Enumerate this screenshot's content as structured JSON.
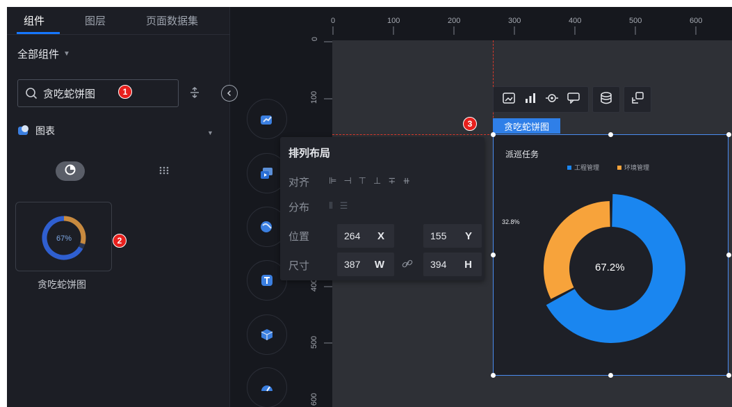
{
  "tabs": [
    {
      "label": "组件",
      "active": true
    },
    {
      "label": "图层",
      "active": false
    },
    {
      "label": "页面数据集",
      "active": false
    }
  ],
  "component_filter": {
    "label": "全部组件"
  },
  "search": {
    "value": "贪吃蛇饼图",
    "badge": "1"
  },
  "category": {
    "label": "图表"
  },
  "component_card": {
    "percent": "67%",
    "label": "贪吃蛇饼图",
    "badge": "2"
  },
  "ruler": {
    "top_ticks": [
      "0",
      "100",
      "200",
      "300",
      "400",
      "500",
      "600"
    ],
    "left_ticks": [
      "0",
      "100",
      "400",
      "500",
      "600"
    ]
  },
  "layout_panel": {
    "title": "排列布局",
    "align_label": "对齐",
    "distribute_label": "分布",
    "position_label": "位置",
    "size_label": "尺寸",
    "x_value": "264",
    "x_unit": "X",
    "y_value": "155",
    "y_unit": "Y",
    "w_value": "387",
    "w_unit": "W",
    "h_value": "394",
    "h_unit": "H"
  },
  "widget": {
    "tag": "贪吃蛇饼图",
    "badge": "3",
    "title": "派巡任务",
    "legend": [
      {
        "label": "工程管理",
        "color": "#1a86f0"
      },
      {
        "label": "环境管理",
        "color": "#f7a33b"
      }
    ],
    "side_percent": "32.8%",
    "center_percent": "67.2%"
  },
  "chart_data": {
    "type": "pie",
    "title": "派巡任务",
    "categories": [
      "工程管理",
      "环境管理"
    ],
    "values": [
      67.2,
      32.8
    ],
    "colors": [
      "#1a86f0",
      "#f7a33b"
    ]
  }
}
